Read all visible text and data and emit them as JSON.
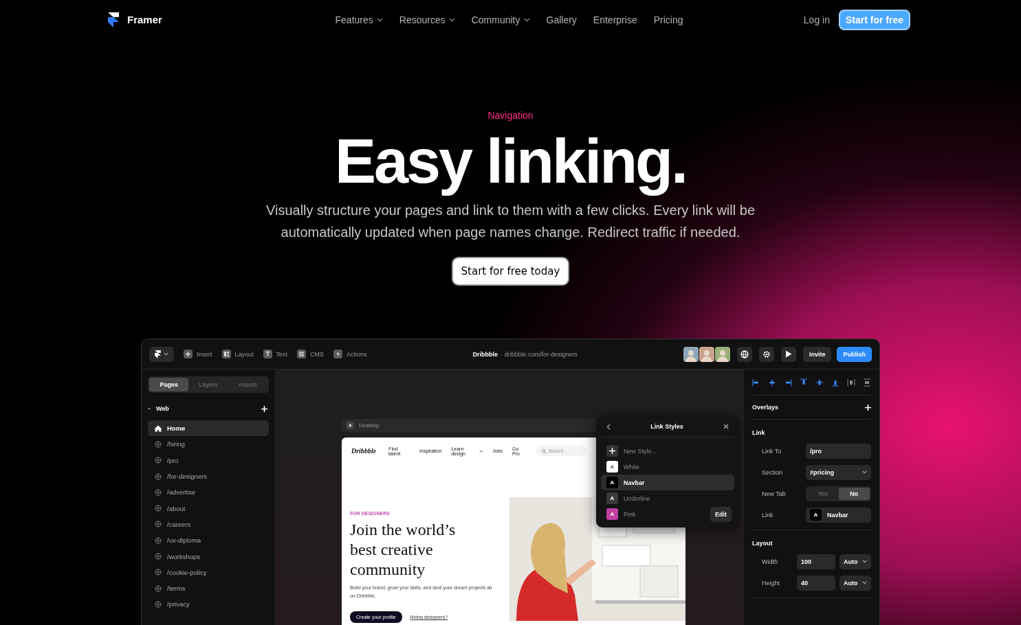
{
  "nav": {
    "brand": "Framer",
    "links": [
      {
        "label": "Features",
        "dropdown": true
      },
      {
        "label": "Resources",
        "dropdown": true
      },
      {
        "label": "Community",
        "dropdown": true
      },
      {
        "label": "Gallery",
        "dropdown": false
      },
      {
        "label": "Enterprise",
        "dropdown": false
      },
      {
        "label": "Pricing",
        "dropdown": false
      }
    ],
    "login": "Log in",
    "cta": "Start for free"
  },
  "hero": {
    "eyebrow": "Navigation",
    "title": "Easy linking.",
    "subtitle": "Visually structure your pages and link to them with a few clicks. Every link will be automatically updated when page names change. Redirect traffic if needed.",
    "button": "Start for free today"
  },
  "app": {
    "toolbar": {
      "tools": [
        {
          "label": "Insert"
        },
        {
          "label": "Layout"
        },
        {
          "label": "Text"
        },
        {
          "label": "CMS"
        },
        {
          "label": "Actions"
        }
      ],
      "site_name": "Dribbble",
      "site_url": "· dribbble.com/for-designers",
      "invite": "Invite",
      "publish": "Publish"
    },
    "sidebar": {
      "tabs": [
        {
          "label": "Pages",
          "selected": true
        },
        {
          "label": "Layers",
          "selected": false
        },
        {
          "label": "Assets",
          "selected": false
        }
      ],
      "section": "Web",
      "pages": [
        {
          "label": "Home",
          "kind": "home",
          "selected": true
        },
        {
          "label": "/hiring",
          "kind": "page",
          "selected": false
        },
        {
          "label": "/pro",
          "kind": "page",
          "selected": false
        },
        {
          "label": "/for-designers",
          "kind": "page",
          "selected": false
        },
        {
          "label": "/advertise",
          "kind": "page",
          "selected": false
        },
        {
          "label": "/about",
          "kind": "page",
          "selected": false
        },
        {
          "label": "/careers",
          "kind": "page",
          "selected": false
        },
        {
          "label": "/ux-diploma",
          "kind": "page",
          "selected": false
        },
        {
          "label": "/workshops",
          "kind": "page",
          "selected": false
        },
        {
          "label": "/cookie-policy",
          "kind": "page",
          "selected": false
        },
        {
          "label": "/terms",
          "kind": "page",
          "selected": false
        },
        {
          "label": "/privacy",
          "kind": "page",
          "selected": false
        }
      ]
    },
    "canvas": {
      "breakpoint": "Desktop",
      "preview": {
        "logo": "Dribbble",
        "links": [
          {
            "label": "Find talent",
            "dropdown": false
          },
          {
            "label": "Inspiration",
            "dropdown": false
          },
          {
            "label": "Learn design",
            "dropdown": true
          },
          {
            "label": "Jobs",
            "dropdown": false
          },
          {
            "label": "Go Pro",
            "dropdown": false
          }
        ],
        "search_placeholder": "Search...",
        "eyebrow": "FOR DESIGNERS",
        "headline": "Join the world’s best creative community",
        "body": "Build your brand, grow your skills, and land your dream projects all on Dribbble.",
        "primary_button": "Create your profile",
        "link": "Hiring designers?"
      }
    }
  },
  "link_styles": {
    "title": "Link Styles",
    "new_style": "New Style...",
    "edit": "Edit",
    "styles": [
      {
        "label": "White",
        "glyph": "A",
        "color": "#ffffff",
        "selected": false
      },
      {
        "label": "Navbar",
        "glyph": "A",
        "color": "#000000",
        "selected": true
      },
      {
        "label": "Underline",
        "glyph": "A",
        "color": "#3a3a3a",
        "selected": false
      },
      {
        "label": "Pink",
        "glyph": "A",
        "color": "#c13fa0",
        "selected": false
      }
    ]
  },
  "properties": {
    "overlays": "Overlays",
    "link_title": "Link",
    "link_to": {
      "label": "Link To",
      "value": "/pro"
    },
    "section": {
      "label": "Section",
      "value": "#pricing"
    },
    "new_tab": {
      "label": "New Tab",
      "options": [
        {
          "label": "Yes",
          "selected": false
        },
        {
          "label": "No",
          "selected": true
        }
      ]
    },
    "link_style": {
      "label": "Link",
      "glyph": "A",
      "value": "Navbar"
    },
    "layout_title": "Layout",
    "width": {
      "label": "Width",
      "value": "100",
      "mode": "Auto"
    },
    "height": {
      "label": "Height",
      "value": "40",
      "mode": "Auto"
    }
  }
}
